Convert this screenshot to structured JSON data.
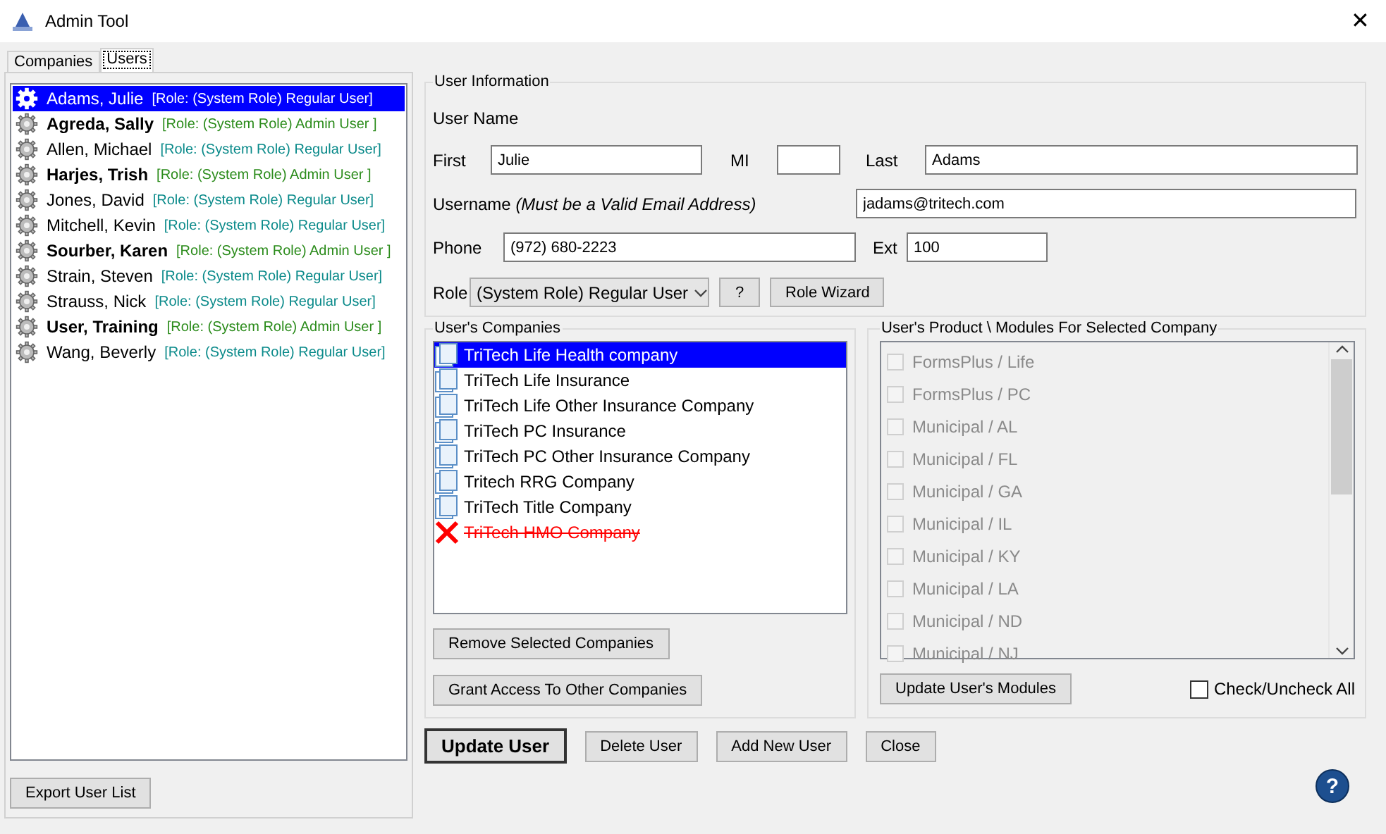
{
  "window": {
    "title": "Admin Tool",
    "close": "✕"
  },
  "tabs": [
    {
      "label": "Companies",
      "selected": false
    },
    {
      "label": "Users",
      "selected": true
    }
  ],
  "users": [
    {
      "name": "Adams, Julie",
      "role": "[Role: (System Role) Regular User]",
      "kind": "regular",
      "selected": true
    },
    {
      "name": "Agreda, Sally",
      "role": "[Role: (System Role) Admin User ]",
      "kind": "admin",
      "color": "#2c8c1c",
      "selected": false
    },
    {
      "name": "Allen, Michael",
      "role": "[Role: (System Role) Regular User]",
      "kind": "regular",
      "color": "#0a8a8a",
      "selected": false
    },
    {
      "name": "Harjes, Trish",
      "role": "[Role: (System Role) Admin User ]",
      "kind": "admin",
      "color": "#2c8c1c",
      "selected": false
    },
    {
      "name": "Jones, David",
      "role": "[Role: (System Role) Regular User]",
      "kind": "regular",
      "color": "#0a8a8a",
      "selected": false
    },
    {
      "name": "Mitchell, Kevin",
      "role": "[Role: (System Role) Regular User]",
      "kind": "regular",
      "color": "#0a8a8a",
      "selected": false
    },
    {
      "name": "Sourber, Karen",
      "role": "[Role: (System Role) Admin User ]",
      "kind": "admin",
      "color": "#2c8c1c",
      "selected": false
    },
    {
      "name": "Strain, Steven",
      "role": "[Role: (System Role) Regular User]",
      "kind": "regular",
      "color": "#0a8a8a",
      "selected": false
    },
    {
      "name": "Strauss, Nick",
      "role": "[Role: (System Role) Regular User]",
      "kind": "regular",
      "color": "#0a8a8a",
      "selected": false
    },
    {
      "name": "User, Training",
      "role": "[Role: (System Role) Admin User ]",
      "kind": "admin",
      "color": "#2c8c1c",
      "selected": false
    },
    {
      "name": "Wang, Beverly",
      "role": "[Role: (System Role) Regular User]",
      "kind": "regular",
      "color": "#0a8a8a",
      "selected": false
    }
  ],
  "export_button": "Export User List",
  "user_information": {
    "title": "User Information",
    "user_name_label": "User Name",
    "first_label": "First",
    "first": "Julie",
    "mi_label": "MI",
    "last_label": "Last",
    "last": "Adams",
    "username_label": "Username *(Must be a Valid Email Address)*",
    "username": "jadams@tritech.com",
    "phone_label": "Phone",
    "phone": "(972) 680-2223",
    "ext_label": "Ext",
    "ext": "100",
    "role_label": "Role",
    "role": "(System Role) Regular User",
    "help_button": "?",
    "wizard_button": "Role Wizard"
  },
  "companies": {
    "title": "User's Companies",
    "items": [
      {
        "name": "TriTech Life Health company",
        "revoked": false,
        "selected": true
      },
      {
        "name": "TriTech Life Insurance",
        "revoked": false,
        "selected": false
      },
      {
        "name": "TriTech Life Other Insurance Company",
        "revoked": false,
        "selected": false
      },
      {
        "name": "TriTech PC Insurance",
        "revoked": false,
        "selected": false
      },
      {
        "name": "TriTech PC Other Insurance Company",
        "revoked": false,
        "selected": false
      },
      {
        "name": "Tritech RRG Company",
        "revoked": false,
        "selected": false
      },
      {
        "name": "TriTech Title Company",
        "revoked": false,
        "selected": false
      },
      {
        "name": "TriTech HMO Company",
        "revoked": true,
        "selected": false
      }
    ],
    "remove_button": "Remove Selected Companies",
    "grant_button": "Grant Access To Other Companies"
  },
  "modules": {
    "title": "User's Product \\ Modules For Selected Company",
    "items": [
      {
        "label": "FormsPlus / Life",
        "checked": false,
        "disabled": true
      },
      {
        "label": "FormsPlus / PC",
        "checked": false,
        "disabled": true
      },
      {
        "label": "Municipal / AL",
        "checked": false,
        "disabled": true
      },
      {
        "label": "Municipal / FL",
        "checked": false,
        "disabled": true
      },
      {
        "label": "Municipal / GA",
        "checked": false,
        "disabled": true
      },
      {
        "label": "Municipal / IL",
        "checked": false,
        "disabled": true
      },
      {
        "label": "Municipal / KY",
        "checked": false,
        "disabled": true
      },
      {
        "label": "Municipal / LA",
        "checked": false,
        "disabled": true
      },
      {
        "label": "Municipal / ND",
        "checked": false,
        "disabled": true
      },
      {
        "label": "Municipal / NJ",
        "checked": false,
        "disabled": true
      }
    ],
    "update_button": "Update User's Modules",
    "check_all": {
      "label": "Check/Uncheck All",
      "checked": false
    }
  },
  "actions": [
    {
      "label": "Update User",
      "kind": "default"
    },
    {
      "label": "Delete User",
      "kind": "normal"
    },
    {
      "label": "Add New User",
      "kind": "normal"
    },
    {
      "label": "Close",
      "kind": "normal"
    }
  ],
  "help": "?"
}
